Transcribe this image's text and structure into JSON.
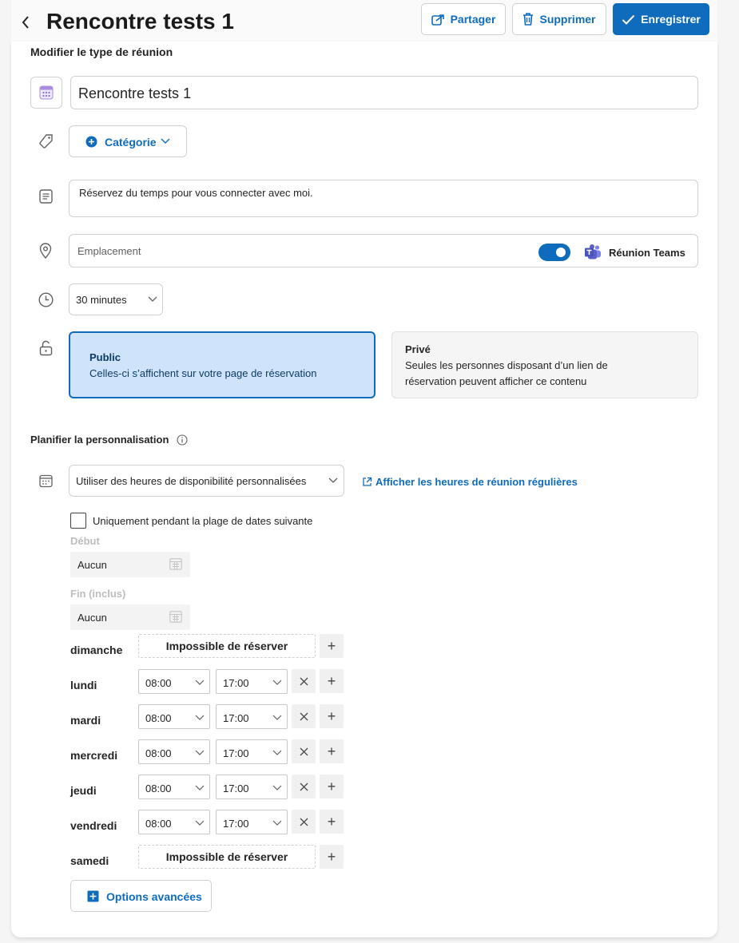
{
  "header": {
    "title": "Rencontre tests 1",
    "share_label": "Partager",
    "delete_label": "Supprimer",
    "save_label": "Enregistrer"
  },
  "edit_section": {
    "title": "Modifier le type de réunion",
    "name_value": "Rencontre tests 1",
    "category_label": "Catégorie",
    "description_value": "Réservez du temps pour vous connecter avec moi.",
    "location_placeholder": "Emplacement",
    "teams_toggle_on": true,
    "teams_label": "Réunion Teams",
    "duration_value": "30 minutes",
    "visibility": {
      "public_title": "Public",
      "public_desc": "Celles-ci s’affichent sur votre page de réservation",
      "private_title": "Privé",
      "private_desc_line1": "Seules les personnes disposant d’un lien de",
      "private_desc_line2": "réservation peuvent afficher ce contenu",
      "selected": "Public"
    }
  },
  "schedule_section": {
    "title": "Planifier la personnalisation",
    "availability_select": "Utiliser des heures de disponibilité personnalisées",
    "regular_hours_link": "Afficher les heures de réunion régulières",
    "date_range_checkbox_label": "Uniquement pendant la plage de dates suivante",
    "date_range_checked": false,
    "start_label": "Début",
    "start_value": "Aucun",
    "end_label": "Fin (inclus)",
    "end_value": "Aucun",
    "unavailable_label": "Impossible de réserver",
    "days": [
      {
        "name": "dimanche",
        "available": false,
        "start": "",
        "end": ""
      },
      {
        "name": "lundi",
        "available": true,
        "start": "08:00",
        "end": "17:00"
      },
      {
        "name": "mardi",
        "available": true,
        "start": "08:00",
        "end": "17:00"
      },
      {
        "name": "mercredi",
        "available": true,
        "start": "08:00",
        "end": "17:00"
      },
      {
        "name": "jeudi",
        "available": true,
        "start": "08:00",
        "end": "17:00"
      },
      {
        "name": "vendredi",
        "available": true,
        "start": "08:00",
        "end": "17:00"
      },
      {
        "name": "samedi",
        "available": false,
        "start": "",
        "end": ""
      }
    ],
    "advanced_options_label": "Options avancées"
  },
  "colors": {
    "accent": "#0f6cbd",
    "selected_card_bg": "#cfe4fa",
    "teams_purple": "#5b5fc7"
  }
}
